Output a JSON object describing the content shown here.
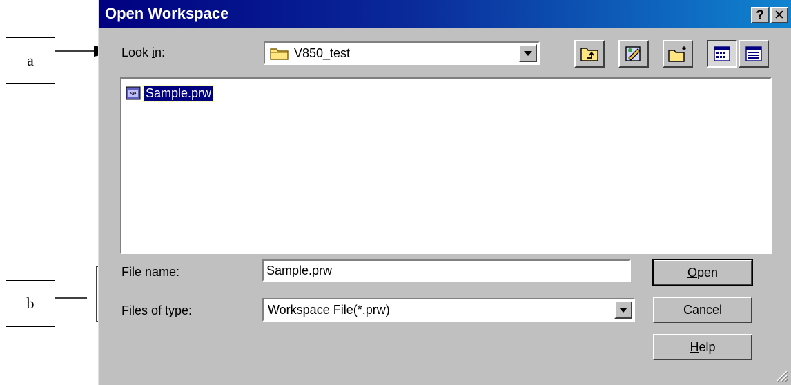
{
  "callouts": {
    "a": "a",
    "b": "b"
  },
  "dialog": {
    "title": "Open Workspace",
    "help_glyph": "?",
    "close_glyph": "✕"
  },
  "look_in": {
    "label_pre": "Look ",
    "label_accel": "i",
    "label_post": "n:",
    "value": "V850_test",
    "icon": "folder-icon"
  },
  "toolbar": {
    "buttons": [
      "up-one-level",
      "favorites",
      "create-new-folder",
      "list-view",
      "details-view"
    ]
  },
  "files": [
    {
      "name": "Sample.prw",
      "icon": "workspace-file-icon",
      "selected": true
    }
  ],
  "file_name": {
    "label_pre": "File ",
    "label_accel": "n",
    "label_post": "ame:",
    "value": "Sample.prw"
  },
  "file_type": {
    "label": "Files of type:",
    "value": "Workspace File(*.prw)"
  },
  "buttons": {
    "open_accel": "O",
    "open_rest": "pen",
    "cancel": "Cancel",
    "help_accel": "H",
    "help_rest": "elp"
  },
  "colors": {
    "titlebar_start": "#000080",
    "titlebar_end": "#1084d0",
    "face": "#c0c0c0",
    "selection": "#000080"
  }
}
